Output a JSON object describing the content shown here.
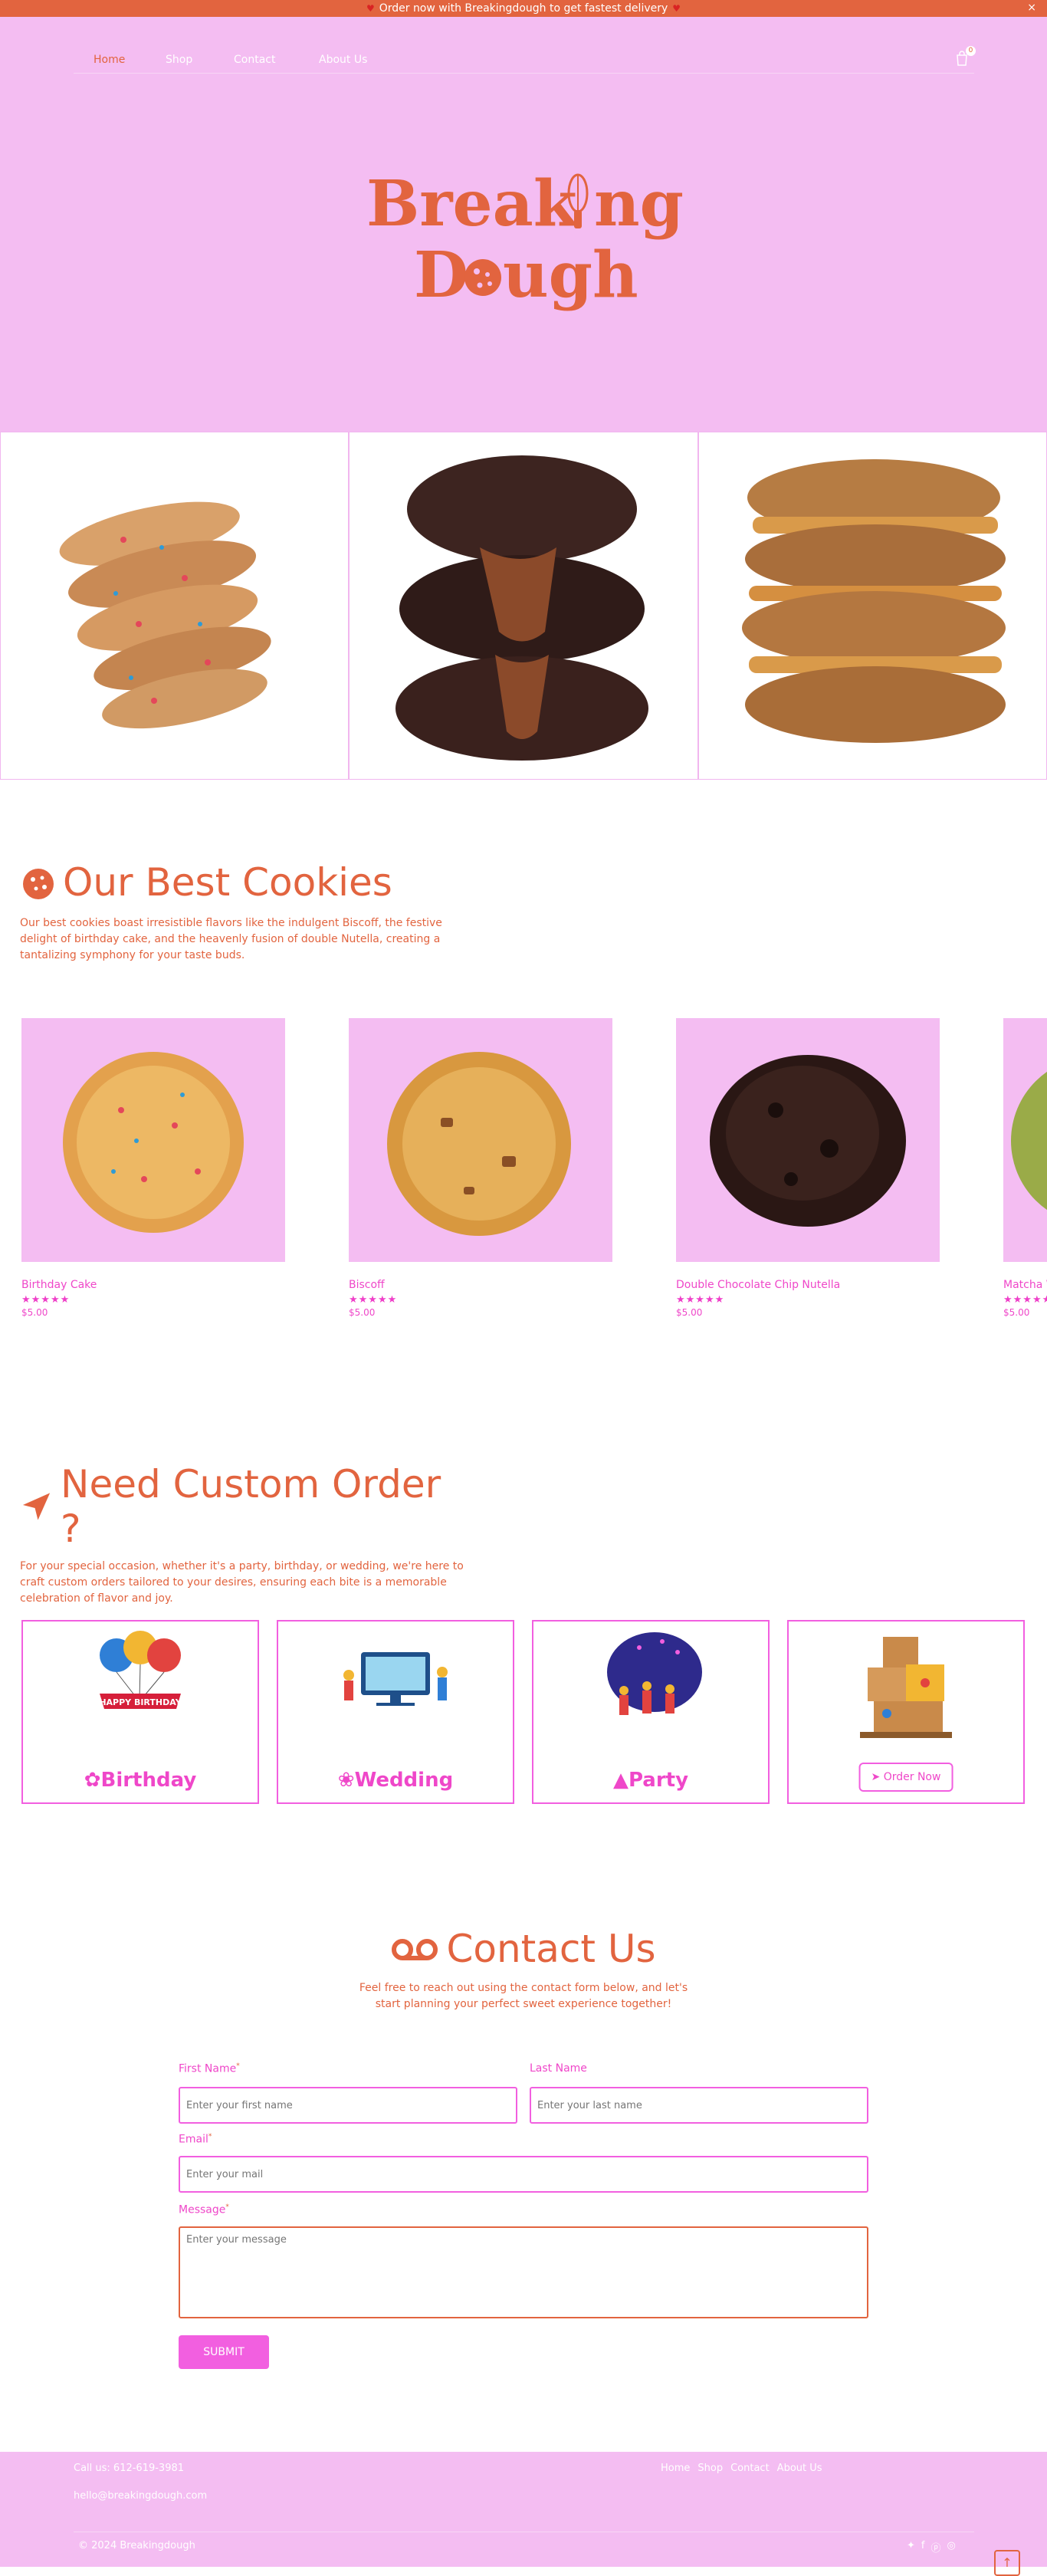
{
  "announcement": {
    "text": "Order now with Breakingdough to get fastest delivery",
    "close": "×"
  },
  "nav": {
    "items": [
      "Home",
      "Shop",
      "Contact",
      "About Us"
    ],
    "cart_count": "0"
  },
  "logo": {
    "text": "Breaking Dough"
  },
  "best": {
    "title": "Our Best Cookies",
    "desc": "Our best cookies boast irresistible flavors like the indulgent Biscoff, the festive delight of birthday cake, and the heavenly fusion of double Nutella, creating a tantalizing symphony for your taste buds.",
    "products": [
      {
        "name": "Birthday Cake",
        "rating": 5,
        "price": "$5.00"
      },
      {
        "name": "Biscoff",
        "rating": 5,
        "price": "$5.00"
      },
      {
        "name": "Double Chocolate Chip Nutella",
        "rating": 5,
        "price": "$5.00"
      },
      {
        "name": "Matcha W",
        "rating": 5,
        "price": "$5.00"
      }
    ]
  },
  "custom": {
    "title": "Need Custom Order ?",
    "desc": "For your special occasion, whether it's a party, birthday, or wedding, we're here to craft custom orders tailored to your desires, ensuring each bite is a memorable celebration of flavor and joy.",
    "cards": {
      "birthday": "Birthday",
      "wedding": "Wedding",
      "party": "Party",
      "order_now": "Order Now"
    },
    "balloon_text": "HAPPY BIRTHDAY"
  },
  "contact": {
    "title": "Contact Us",
    "desc": "Feel free to reach out using the contact form below, and let's start planning your perfect sweet experience together!",
    "form": {
      "first_label": "First Name",
      "first_placeholder": "Enter your first name",
      "last_label": "Last Name",
      "last_placeholder": "Enter your last name",
      "email_label": "Email",
      "email_placeholder": "Enter your mail",
      "message_label": "Message",
      "message_placeholder": "Enter your message",
      "submit": "SUBMIT"
    }
  },
  "footer": {
    "phone": "Call us: 612-619-3981",
    "email": "hello@breakingdough.com",
    "links": [
      "Home",
      "Shop",
      "Contact",
      "About Us"
    ],
    "copyright": "© 2024 Breakingdough",
    "to_top": "↑"
  },
  "colors": {
    "brand": "#e2643f",
    "pink": "#f4bdf2",
    "magenta": "#f25fe0"
  }
}
